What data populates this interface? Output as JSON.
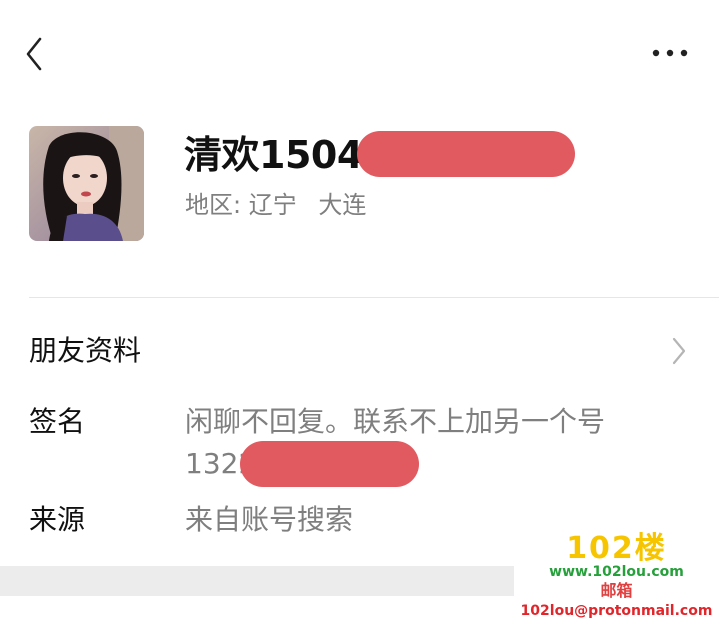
{
  "header": {
    "back_icon": "chevron-left-icon",
    "more_icon": "more-horizontal-icon"
  },
  "profile": {
    "name": "清欢1504",
    "region_label": "地区:",
    "region_province": "辽宁",
    "region_city": "大连",
    "redaction_color": "#e05a60"
  },
  "friend_info": {
    "label": "朋友资料",
    "chevron_icon": "chevron-right-icon"
  },
  "fields": {
    "signature_label": "签名",
    "signature_line1": "闲聊不回复。联系不上加另一个号",
    "signature_line2": "1322",
    "source_label": "来源",
    "source_value": "来自账号搜索"
  },
  "watermark": {
    "logo": "102楼",
    "url": "www.102lou.com",
    "mail_label": "邮箱",
    "mail": "102lou@protonmail.com"
  }
}
